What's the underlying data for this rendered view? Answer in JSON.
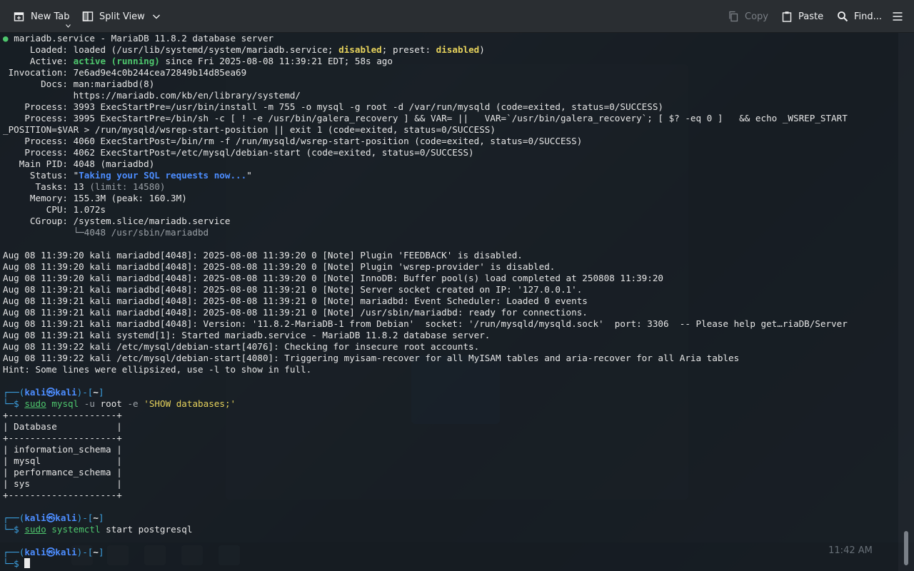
{
  "toolbar": {
    "new_tab": "New Tab",
    "split_view": "Split View",
    "copy": "Copy",
    "paste": "Paste",
    "find": "Find..."
  },
  "terminal": {
    "status": {
      "header": "mariadb.service - MariaDB 11.8.2 database server",
      "loaded_label": "     Loaded: ",
      "loaded_a": "loaded (/usr/lib/systemd/system/mariadb.service; ",
      "loaded_disabled": "disabled",
      "loaded_b": "; preset: ",
      "loaded_preset": "disabled",
      "loaded_c": ")",
      "active_label": "     Active: ",
      "active_state": "active (running)",
      "active_rest": " since Fri 2025-08-08 11:39:21 EDT; 58s ago",
      "invocation": " Invocation: 7e6ad9e4c0b244cea72849b14d85ea69",
      "docs1": "       Docs: man:mariadbd(8)",
      "docs2": "             https://mariadb.com/kb/en/library/systemd/",
      "proc1": "    Process: 3993 ExecStartPre=/usr/bin/install -m 755 -o mysql -g root -d /var/run/mysqld (code=exited, status=0/SUCCESS)",
      "proc2": "    Process: 3995 ExecStartPre=/bin/sh -c [ ! -e /usr/bin/galera_recovery ] && VAR= ||   VAR=`/usr/bin/galera_recovery`; [ $? -eq 0 ]   && echo _WSREP_START",
      "proc2b": "_POSITION=$VAR > /run/mysqld/wsrep-start-position || exit 1 (code=exited, status=0/SUCCESS)",
      "proc3": "    Process: 4060 ExecStartPost=/bin/rm -f /run/mysqld/wsrep-start-position (code=exited, status=0/SUCCESS)",
      "proc4": "    Process: 4062 ExecStartPost=/etc/mysql/debian-start (code=exited, status=0/SUCCESS)",
      "mainpid": "   Main PID: 4048 (mariadbd)",
      "status_label": "     Status: \"",
      "status_value": "Taking your SQL requests now...",
      "status_end": "\"",
      "tasks_label": "      Tasks: 13 ",
      "tasks_limit": "(limit: 14580)",
      "memory": "     Memory: 155.3M (peak: 160.3M)",
      "cpu": "        CPU: 1.072s",
      "cgroup": "     CGroup: /system.slice/mariadb.service",
      "cgroup_child": "             └─4048 /usr/sbin/mariadbd"
    },
    "log": [
      "Aug 08 11:39:20 kali mariadbd[4048]: 2025-08-08 11:39:20 0 [Note] Plugin 'FEEDBACK' is disabled.",
      "Aug 08 11:39:20 kali mariadbd[4048]: 2025-08-08 11:39:20 0 [Note] Plugin 'wsrep-provider' is disabled.",
      "Aug 08 11:39:20 kali mariadbd[4048]: 2025-08-08 11:39:20 0 [Note] InnoDB: Buffer pool(s) load completed at 250808 11:39:20",
      "Aug 08 11:39:21 kali mariadbd[4048]: 2025-08-08 11:39:21 0 [Note] Server socket created on IP: '127.0.0.1'.",
      "Aug 08 11:39:21 kali mariadbd[4048]: 2025-08-08 11:39:21 0 [Note] mariadbd: Event Scheduler: Loaded 0 events",
      "Aug 08 11:39:21 kali mariadbd[4048]: 2025-08-08 11:39:21 0 [Note] /usr/sbin/mariadbd: ready for connections.",
      "Aug 08 11:39:21 kali mariadbd[4048]: Version: '11.8.2-MariaDB-1 from Debian'  socket: '/run/mysqld/mysqld.sock'  port: 3306  -- Please help get…riaDB/Server",
      "Aug 08 11:39:21 kali systemd[1]: Started mariadb.service - MariaDB 11.8.2 database server.",
      "Aug 08 11:39:22 kali /etc/mysql/debian-start[4076]: Checking for insecure root accounts.",
      "Aug 08 11:39:22 kali /etc/mysql/debian-start[4080]: Triggering myisam-recover for all MyISAM tables and aria-recover for all Aria tables",
      "Hint: Some lines were ellipsized, use -l to show in full."
    ],
    "prompt": {
      "top_a": "┌──(",
      "user": "kali",
      "at": "㉿",
      "host": "kali",
      "top_b": ")-[",
      "dir": "~",
      "top_c": "]",
      "bottom": "└─$ "
    },
    "cmd1": {
      "sudo": "sudo",
      "bin": "mysql",
      "args": " -u ",
      "user": "root",
      "flag": " -e ",
      "str": "'SHOW databases;'"
    },
    "db_table": [
      "+--------------------+",
      "| Database           |",
      "+--------------------+",
      "| information_schema |",
      "| mysql              |",
      "| performance_schema |",
      "| sys                |",
      "+--------------------+"
    ],
    "cmd2": {
      "sudo": "sudo",
      "bin": "systemctl",
      "args": " start postgresql"
    }
  },
  "tray": {
    "time": "11:42 AM"
  }
}
